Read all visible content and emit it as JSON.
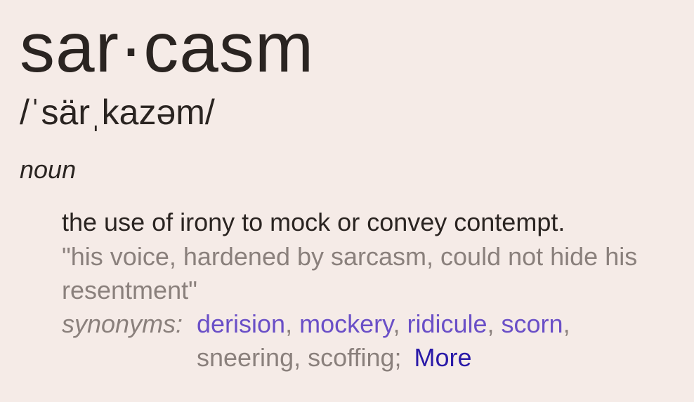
{
  "entry": {
    "headword": "sar·casm",
    "phonetic": "/ˈsärˌkazəm/",
    "part_of_speech": "noun",
    "definition": "the use of irony to mock or convey contempt.",
    "example": "\"his voice, hardened by sarcasm, could not hide his resentment\"",
    "synonyms_label": "synonyms:",
    "synonyms_linked": [
      "derision",
      "mockery",
      "ridicule",
      "scorn"
    ],
    "synonyms_plain": [
      "sneering",
      "scoffing"
    ],
    "more_label": "More"
  },
  "colors": {
    "background": "#f5ebe7",
    "text": "#2a2421",
    "muted": "#8a807c",
    "synonym_link": "#6a4fc7",
    "more_link": "#2a1aa8"
  }
}
